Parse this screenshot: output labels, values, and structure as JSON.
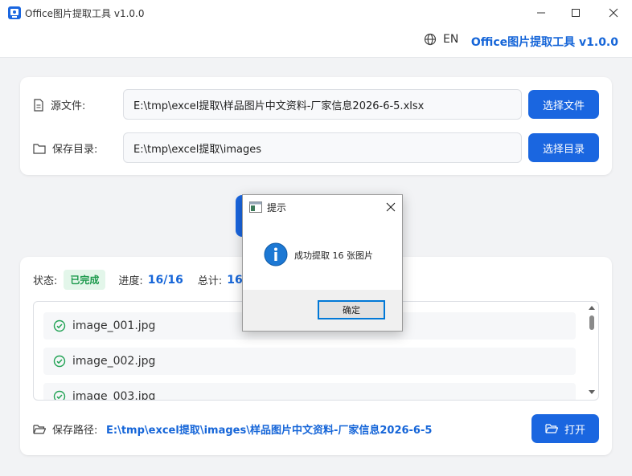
{
  "window": {
    "title": "Office图片提取工具 v1.0.0"
  },
  "header": {
    "language": "EN",
    "brand": "Office图片提取工具 v1.0.0"
  },
  "source": {
    "label": "源文件:",
    "value": "E:\\tmp\\excel提取\\样品图片中文资料-厂家信息2026-6-5.xlsx",
    "button": "选择文件"
  },
  "output": {
    "label": "保存目录:",
    "value": "E:\\tmp\\excel提取\\images",
    "button": "选择目录"
  },
  "status": {
    "label": "状态:",
    "badge": "已完成",
    "progress_label": "进度:",
    "progress_value": "16/16",
    "total_label": "总计:",
    "total_value": "16"
  },
  "files": [
    {
      "name": "image_001.jpg"
    },
    {
      "name": "image_002.jpg"
    },
    {
      "name": "image_003.jpg"
    }
  ],
  "save_path": {
    "label": "保存路径:",
    "value": "E:\\tmp\\excel提取\\images\\样品图片中文资料-厂家信息2026-6-5",
    "open_button": "打开"
  },
  "dialog": {
    "title": "提示",
    "message": "成功提取 16 张图片",
    "ok": "确定"
  },
  "colors": {
    "primary": "#1a66e0",
    "brand_text": "#1565d8",
    "success": "#1d9a4d",
    "success_bg": "#e3f6ea"
  }
}
